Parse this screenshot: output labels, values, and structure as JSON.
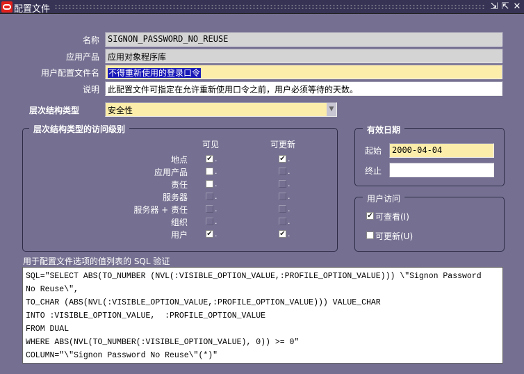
{
  "window": {
    "title": "配置文件",
    "minimize": "⇲",
    "maximize": "⇱",
    "close": "✕"
  },
  "form": {
    "name_label": "名称",
    "name_value": "SIGNON_PASSWORD_NO_REUSE",
    "app_label": "应用产品",
    "app_value": "应用对象程序库",
    "username_label": "用户配置文件名",
    "username_value": "不得重新使用的登录口令",
    "desc_label": "说明",
    "desc_value": "此配置文件可指定在允许重新使用口令之前，用户必须等待的天数。",
    "hier_label": "层次结构类型",
    "hier_value": "安全性"
  },
  "access": {
    "title": "层次结构类型的访问级别",
    "col_visible": "可见",
    "col_update": "可更新",
    "rows": [
      {
        "label": "地点",
        "visible": "checked",
        "update": "checked"
      },
      {
        "label": "应用产品",
        "visible": "unchecked",
        "update": "disabled"
      },
      {
        "label": "责任",
        "visible": "unchecked",
        "update": "disabled"
      },
      {
        "label": "服务器",
        "visible": "disabled",
        "update": "disabled"
      },
      {
        "label": "服务器 + 责任",
        "visible": "disabled",
        "update": "disabled"
      },
      {
        "label": "组织",
        "visible": "disabled",
        "update": "disabled"
      },
      {
        "label": "用户",
        "visible": "checked",
        "update": "checked"
      }
    ]
  },
  "dates": {
    "title": "有效日期",
    "start_label": "起始",
    "start_value": "2000-04-04",
    "end_label": "终止",
    "end_value": ""
  },
  "user_access": {
    "title": "用户访问",
    "view_label": "可查看(I)",
    "view_checked": true,
    "update_label": "可更新(U)",
    "update_checked": false
  },
  "sql": {
    "label": "用于配置文件选项的值列表的 SQL 验证",
    "value": "SQL=\"SELECT ABS(TO_NUMBER (NVL(:VISIBLE_OPTION_VALUE,:PROFILE_OPTION_VALUE))) \\\"Signon Password\nNo Reuse\\\",\nTO_CHAR (ABS(NVL(:VISIBLE_OPTION_VALUE,:PROFILE_OPTION_VALUE))) VALUE_CHAR\nINTO :VISIBLE_OPTION_VALUE,  :PROFILE_OPTION_VALUE\nFROM DUAL\nWHERE ABS(NVL(TO_NUMBER(:VISIBLE_OPTION_VALUE), 0)) >= 0\"\nCOLUMN=\"\\\"Signon Password No Reuse\\\"(*)\""
  }
}
